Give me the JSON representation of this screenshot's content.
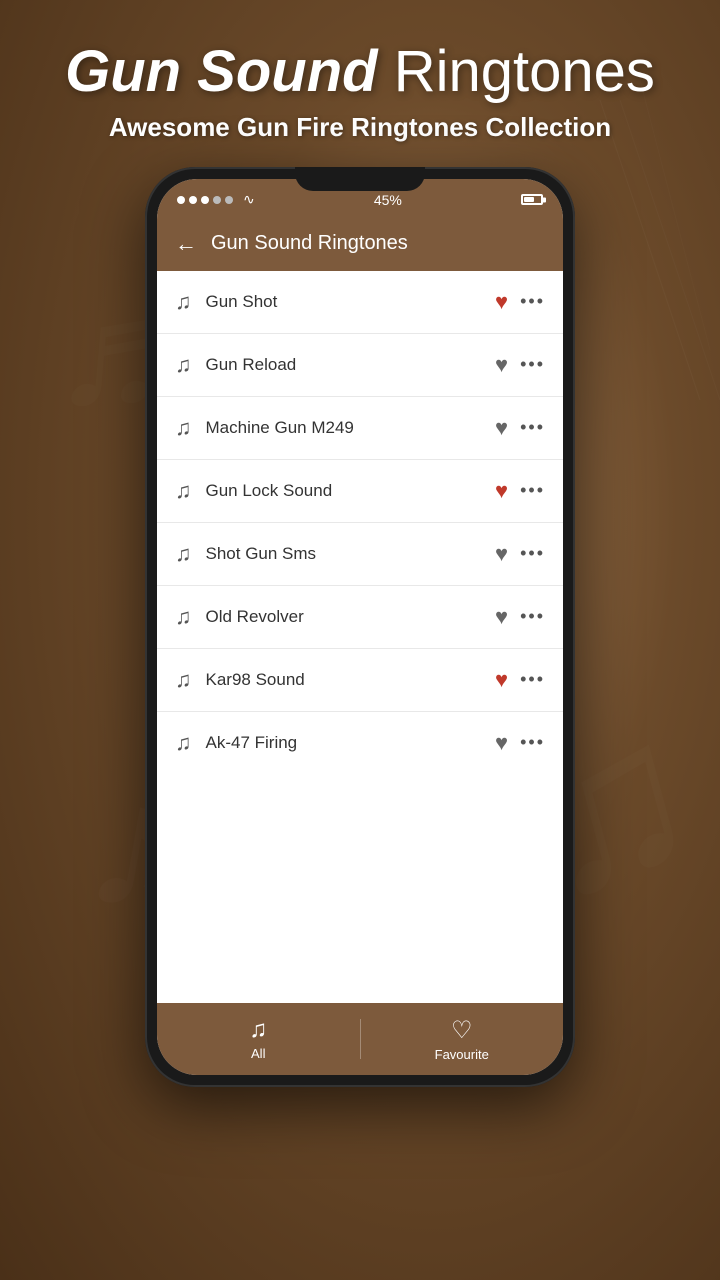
{
  "background": {
    "color1": "#a07850",
    "color2": "#6b4a2a",
    "color3": "#4a3018"
  },
  "header": {
    "title_part1": "Gun Sound",
    "title_part2": "Ringtones",
    "subtitle": "Awesome Gun Fire Ringtones Collection"
  },
  "app": {
    "title": "Gun Sound Ringtones",
    "back_label": "←"
  },
  "status_bar": {
    "battery": "45%",
    "signal_dots": [
      "filled",
      "filled",
      "filled",
      "empty",
      "empty"
    ],
    "wifi": "wifi"
  },
  "ringtones": [
    {
      "id": 1,
      "name": "Gun Shot",
      "favorited": true
    },
    {
      "id": 2,
      "name": "Gun Reload",
      "favorited": false
    },
    {
      "id": 3,
      "name": "Machine Gun M249",
      "favorited": false
    },
    {
      "id": 4,
      "name": "Gun Lock Sound",
      "favorited": true
    },
    {
      "id": 5,
      "name": "Shot Gun Sms",
      "favorited": false
    },
    {
      "id": 6,
      "name": "Old Revolver",
      "favorited": false
    },
    {
      "id": 7,
      "name": "Kar98 Sound",
      "favorited": true
    },
    {
      "id": 8,
      "name": "Ak-47 Firing",
      "favorited": false
    }
  ],
  "bottom_nav": [
    {
      "id": "all",
      "label": "All",
      "icon": "♫"
    },
    {
      "id": "favourite",
      "label": "Favourite",
      "icon": "♡"
    }
  ]
}
